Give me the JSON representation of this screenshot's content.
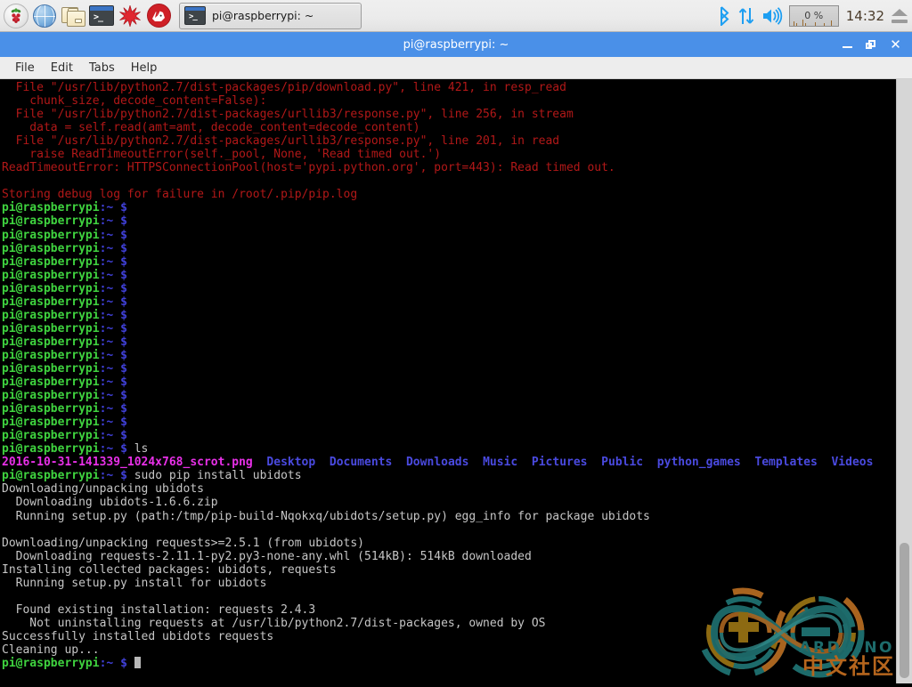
{
  "taskbar": {
    "launchers": [
      {
        "name": "raspberry-menu-icon",
        "label": "Raspberry Pi Menu"
      },
      {
        "name": "web-browser-icon",
        "label": "Web Browser"
      },
      {
        "name": "file-manager-icon",
        "label": "File Manager"
      },
      {
        "name": "terminal-icon",
        "label": "Terminal"
      },
      {
        "name": "mathematica-icon",
        "label": "Mathematica"
      },
      {
        "name": "wolfram-icon",
        "label": "Wolfram"
      }
    ],
    "task_button": {
      "icon": "terminal-icon",
      "label": "pi@raspberrypi: ~"
    },
    "tray": {
      "bluetooth_icon": "bluetooth-icon",
      "network_icon": "network-updown-icon",
      "volume_icon": "volume-icon",
      "cpu_label": "0 %",
      "clock": "14:32",
      "eject_icon": "eject-icon"
    }
  },
  "window": {
    "title": "pi@raspberrypi: ~",
    "controls": {
      "minimize": "minimize-button",
      "maximize": "maximize-button",
      "close": "close-button"
    },
    "menus": [
      "File",
      "Edit",
      "Tabs",
      "Help"
    ]
  },
  "terminal": {
    "prompt": {
      "user_host": "pi@raspberrypi",
      "path": ":~",
      "sigil": "$"
    },
    "empty_prompt_count": 18,
    "traceback": [
      "  File \"/usr/lib/python2.7/dist-packages/pip/download.py\", line 421, in resp_read",
      "    chunk_size, decode_content=False):",
      "  File \"/usr/lib/python2.7/dist-packages/urllib3/response.py\", line 256, in stream",
      "    data = self.read(amt=amt, decode_content=decode_content)",
      "  File \"/usr/lib/python2.7/dist-packages/urllib3/response.py\", line 201, in read",
      "    raise ReadTimeoutError(self._pool, None, 'Read timed out.')",
      "ReadTimeoutError: HTTPSConnectionPool(host='pypi.python.org', port=443): Read timed out.",
      "",
      "Storing debug log for failure in /root/.pip/pip.log"
    ],
    "ls_command": "ls",
    "ls_output": {
      "file": "2016-10-31-141339_1024x768_scrot.png",
      "dirs": [
        "Desktop",
        "Documents",
        "Downloads",
        "Music",
        "Pictures",
        "Public",
        "python_games",
        "Templates",
        "Videos"
      ]
    },
    "pip_command": "sudo pip install ubidots",
    "pip_output": [
      "Downloading/unpacking ubidots",
      "  Downloading ubidots-1.6.6.zip",
      "  Running setup.py (path:/tmp/pip-build-Nqokxq/ubidots/setup.py) egg_info for package ubidots",
      "",
      "Downloading/unpacking requests>=2.5.1 (from ubidots)",
      "  Downloading requests-2.11.1-py2.py3-none-any.whl (514kB): 514kB downloaded",
      "Installing collected packages: ubidots, requests",
      "  Running setup.py install for ubidots",
      "",
      "  Found existing installation: requests 2.4.3",
      "    Not uninstalling requests at /usr/lib/python2.7/dist-packages, owned by OS",
      "Successfully installed ubidots requests",
      "Cleaning up..."
    ]
  },
  "watermark": {
    "brand": "ARDUINO",
    "brand_cn": "中文社区"
  },
  "colors": {
    "titlebar": "#4a90e8",
    "terminal_bg": "#000000",
    "prompt_green": "#3fd33f",
    "prompt_blue": "#4040d8",
    "error_red": "#b21818",
    "dir_blue": "#4a4ae0",
    "png_magenta": "#e830e8",
    "watermark_teal": "#1d6b6b",
    "watermark_orange": "#b5651d"
  }
}
